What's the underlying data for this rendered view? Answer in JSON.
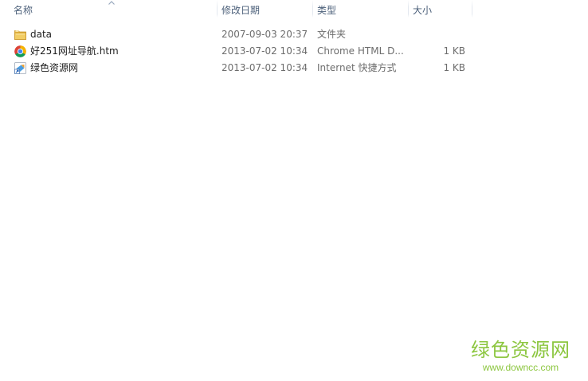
{
  "columns": {
    "name": "名称",
    "date": "修改日期",
    "type": "类型",
    "size": "大小"
  },
  "files": [
    {
      "name": "data",
      "date": "2007-09-03 20:37",
      "type": "文件夹",
      "size": "",
      "icon": "folder-icon"
    },
    {
      "name": "好251网址导航.htm",
      "date": "2013-07-02 10:34",
      "type": "Chrome HTML D...",
      "size": "1 KB",
      "icon": "chrome-icon"
    },
    {
      "name": "绿色资源网",
      "date": "2013-07-02 10:34",
      "type": "Internet 快捷方式",
      "size": "1 KB",
      "icon": "internet-shortcut-icon"
    }
  ],
  "watermark": {
    "title": "绿色资源网",
    "url": "www.downcc.com"
  },
  "colors": {
    "header_text": "#4c607a",
    "detail_text": "#6d6d6d",
    "watermark": "#8cc63f",
    "folder": "#e8c15a"
  }
}
